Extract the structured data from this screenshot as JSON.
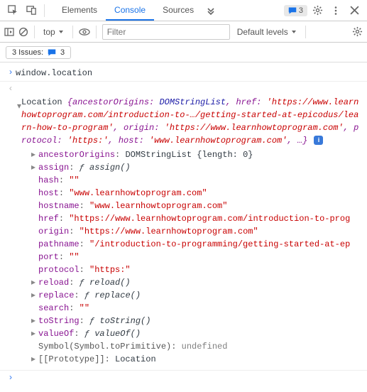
{
  "topbar": {
    "tabs": [
      "Elements",
      "Console",
      "Sources"
    ],
    "activeTab": 1,
    "msgCount": "3"
  },
  "subbar": {
    "context": "top",
    "filterPlaceholder": "Filter",
    "levels": "Default levels"
  },
  "thirdbar": {
    "issuesLabel": "3 Issues:",
    "issuesCount": "3"
  },
  "cmdline": "window.location",
  "header": {
    "cls": "Location ",
    "seg1_k": "{ancestorOrigins: ",
    "seg1_v": "DOMStringList",
    "seg2_k": ", href: ",
    "seg2_v": "'https://www.learnhowtoprogram.com/introduction-to-…/getting-started-at-epicodus/learn-how-to-program'",
    "seg3_k": ", origin: ",
    "seg3_v": "'https://www.learnhowtoprogram.com'",
    "seg4_k": ", protocol: ",
    "seg4_v": "'https:'",
    "seg5_k": ", host: ",
    "seg5_v": "'www.learnhowtoprogram.com'",
    "seg6": ", …}"
  },
  "props": {
    "ancestor_k": "ancestorOrigins",
    "ancestor_v": "DOMStringList {length: 0}",
    "assign_k": "assign",
    "assign_v": "ƒ assign()",
    "hash_k": "hash",
    "hash_v": "\"\"",
    "host_k": "host",
    "host_v": "\"www.learnhowtoprogram.com\"",
    "hostname_k": "hostname",
    "hostname_v": "\"www.learnhowtoprogram.com\"",
    "href_k": "href",
    "href_v": "\"https://www.learnhowtoprogram.com/introduction-to-prog",
    "origin_k": "origin",
    "origin_v": "\"https://www.learnhowtoprogram.com\"",
    "pathname_k": "pathname",
    "pathname_v": "\"/introduction-to-programming/getting-started-at-ep",
    "port_k": "port",
    "port_v": "\"\"",
    "protocol_k": "protocol",
    "protocol_v": "\"https:\"",
    "reload_k": "reload",
    "reload_v": "ƒ reload()",
    "replace_k": "replace",
    "replace_v": "ƒ replace()",
    "search_k": "search",
    "search_v": "\"\"",
    "tostring_k": "toString",
    "tostring_v": "ƒ toString()",
    "valueof_k": "valueOf",
    "valueof_v": "ƒ valueOf()",
    "symbol_k": "Symbol(Symbol.toPrimitive)",
    "symbol_v": "undefined",
    "proto_k": "[[Prototype]]",
    "proto_v": "Location"
  }
}
